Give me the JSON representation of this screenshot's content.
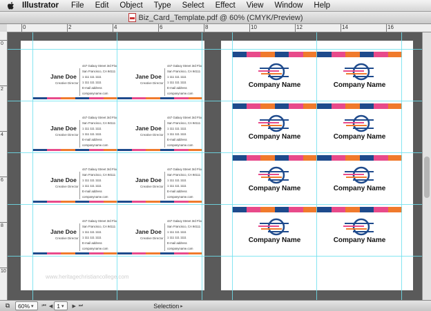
{
  "menubar": {
    "app_name": "Illustrator",
    "items": [
      "File",
      "Edit",
      "Object",
      "Type",
      "Select",
      "Effect",
      "View",
      "Window",
      "Help"
    ]
  },
  "document": {
    "title": "Biz_Card_Template.pdf @ 60% (CMYK/Preview)"
  },
  "ruler": {
    "top_labels": [
      "0",
      "2",
      "4",
      "6",
      "8",
      "10",
      "12",
      "14",
      "16"
    ],
    "left_labels": [
      "0",
      "2",
      "4",
      "6",
      "8",
      "10"
    ]
  },
  "business_card": {
    "name": "Jane Doe",
    "title": "Creative Director",
    "address1": "447 Galaxy Street 3rd Floor",
    "address2": "San Francisco, CA 94111",
    "phone1": "1 111 111 1111",
    "phone2": "1 111 111 1111",
    "email": "E-mail address",
    "website": "companyname.com"
  },
  "logo_card": {
    "company": "Company Name"
  },
  "colors": {
    "navy": "#1e4a8c",
    "pink": "#e84a8a",
    "orange": "#f07a2c",
    "guide": "#6ee0ee"
  },
  "watermark": "www.heritagechristiancollege.com",
  "statusbar": {
    "zoom": "60%",
    "page": "1",
    "tool": "Selection"
  }
}
